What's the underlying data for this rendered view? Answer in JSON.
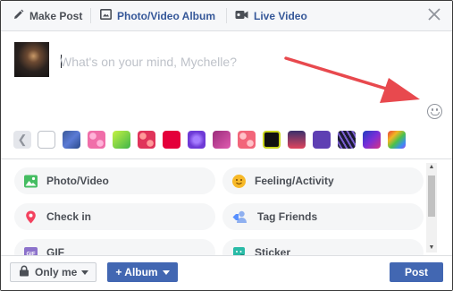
{
  "header": {
    "tabs": [
      {
        "label": "Make Post",
        "icon": "pencil-icon",
        "active": true
      },
      {
        "label": "Photo/Video Album",
        "icon": "photo-album-icon",
        "active": false
      },
      {
        "label": "Live Video",
        "icon": "video-camera-icon",
        "active": false
      }
    ],
    "close_icon": "close-icon"
  },
  "composer": {
    "placeholder": "What's on your mind, Mychelle?",
    "value": "",
    "emoji_icon": "smiley-icon"
  },
  "annotation": {
    "arrow_color": "#e8494e"
  },
  "backgrounds": {
    "prev_icon": "chevron-left-icon",
    "swatches": [
      {
        "name": "white",
        "color": "#ffffff"
      },
      {
        "name": "blue-pattern",
        "color": "#3b5998"
      },
      {
        "name": "pink-dots",
        "color": "#f06ea9"
      },
      {
        "name": "green-gradient",
        "color": "#7bd12b"
      },
      {
        "name": "red-pattern",
        "color": "#e0345a"
      },
      {
        "name": "red",
        "color": "#e4003a"
      },
      {
        "name": "purple-pattern",
        "color": "#6e3ad6"
      },
      {
        "name": "magenta-heart",
        "color": "#c3358f"
      },
      {
        "name": "coral-pattern",
        "color": "#f2667a"
      },
      {
        "name": "black-neon",
        "color": "#1a1a1a"
      },
      {
        "name": "dusk-gradient",
        "color": "#b1305a"
      },
      {
        "name": "violet",
        "color": "#5e3fb3"
      },
      {
        "name": "dark-stripes",
        "color": "#2c2a48"
      },
      {
        "name": "blue-wave",
        "color": "#1f3fbf"
      },
      {
        "name": "rainbow",
        "color": "#f2b624"
      }
    ]
  },
  "options": [
    {
      "label": "Photo/Video",
      "icon": "photo-icon",
      "color": "#45bd62"
    },
    {
      "label": "Feeling/Activity",
      "icon": "feeling-emoji-icon",
      "color": "#f7b928"
    },
    {
      "label": "Check in",
      "icon": "location-pin-icon",
      "color": "#f3425f"
    },
    {
      "label": "Tag Friends",
      "icon": "tag-friends-icon",
      "color": "#5890ff"
    },
    {
      "label": "GIF",
      "icon": "gif-icon",
      "color": "#8c72cb"
    },
    {
      "label": "Sticker",
      "icon": "sticker-icon",
      "color": "#2abba7"
    }
  ],
  "footer": {
    "privacy_label": "Only me",
    "privacy_icon": "lock-icon",
    "album_label": "+ Album",
    "post_label": "Post"
  }
}
